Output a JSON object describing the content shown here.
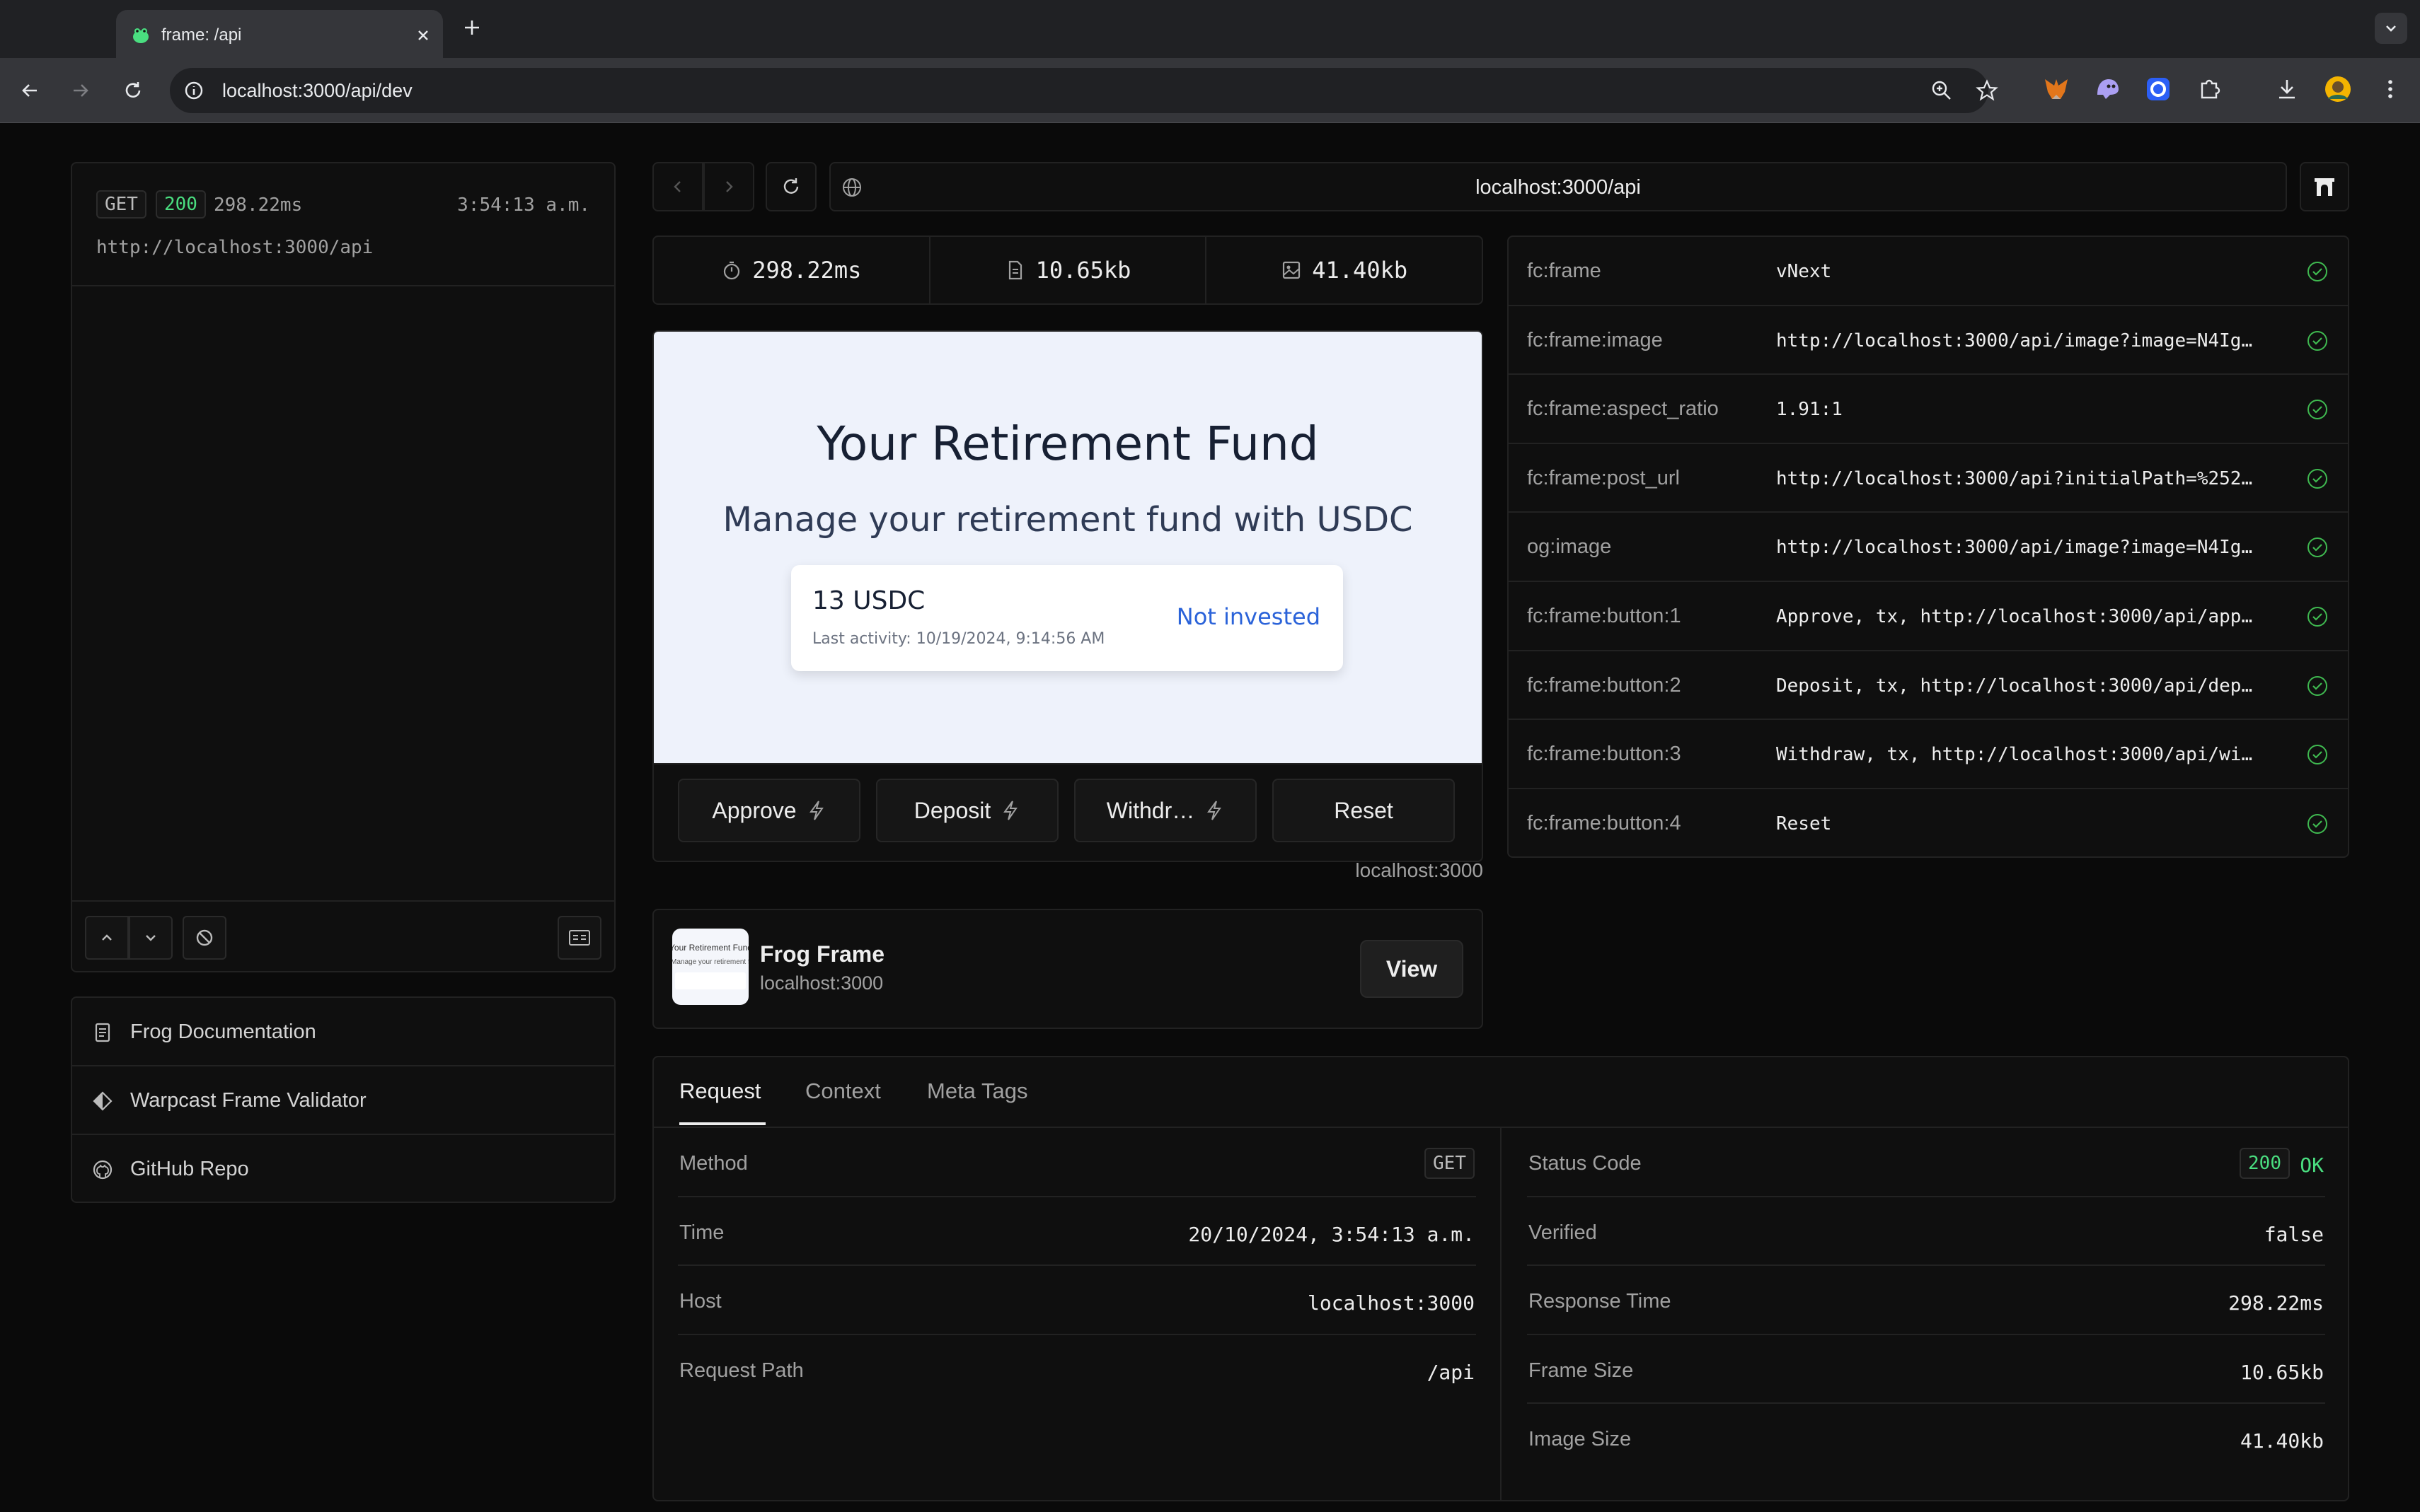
{
  "browser": {
    "tab_title": "frame: /api",
    "url": "localhost:3000/api/dev"
  },
  "log": {
    "method": "GET",
    "status": "200",
    "duration": "298.22ms",
    "time": "3:54:13 a.m.",
    "url": "http://localhost:3000/api"
  },
  "links": [
    {
      "label": "Frog Documentation",
      "icon": "document-icon"
    },
    {
      "label": "Warpcast Frame Validator",
      "icon": "warpcast-icon"
    },
    {
      "label": "GitHub Repo",
      "icon": "github-icon"
    }
  ],
  "navbar": {
    "url": "localhost:3000/api"
  },
  "metrics": {
    "time": "298.22ms",
    "frame_size": "10.65kb",
    "image_size": "41.40kb"
  },
  "frame": {
    "title": "Your Retirement Fund",
    "subtitle": "Manage your retirement fund with USDC",
    "amount": "13 USDC",
    "last_activity": "Last activity: 10/19/2024, 9:14:56 AM",
    "status": "Not invested",
    "buttons": [
      {
        "label": "Approve",
        "icon": "bolt-icon"
      },
      {
        "label": "Deposit",
        "icon": "bolt-icon"
      },
      {
        "label": "Withdr…",
        "icon": "bolt-icon"
      },
      {
        "label": "Reset"
      }
    ],
    "host": "localhost:3000",
    "thumb_title": "Your Retirement Fund",
    "thumb_sub": "Manage your retirement fund with USDC"
  },
  "cast": {
    "title": "Frog Frame",
    "host": "localhost:3000",
    "view_label": "View"
  },
  "meta_tags": [
    {
      "key": "fc:frame",
      "value": "vNext"
    },
    {
      "key": "fc:frame:image",
      "value": "http://localhost:3000/api/image?image=N4Ig…"
    },
    {
      "key": "fc:frame:aspect_ratio",
      "value": "1.91:1"
    },
    {
      "key": "fc:frame:post_url",
      "value": "http://localhost:3000/api?initialPath=%252…"
    },
    {
      "key": "og:image",
      "value": "http://localhost:3000/api/image?image=N4Ig…"
    },
    {
      "key": "fc:frame:button:1",
      "value": "Approve, tx, http://localhost:3000/api/app…"
    },
    {
      "key": "fc:frame:button:2",
      "value": "Deposit, tx, http://localhost:3000/api/dep…"
    },
    {
      "key": "fc:frame:button:3",
      "value": "Withdraw, tx, http://localhost:3000/api/wi…"
    },
    {
      "key": "fc:frame:button:4",
      "value": "Reset"
    }
  ],
  "request": {
    "tabs": [
      "Request",
      "Context",
      "Meta Tags"
    ],
    "method_label": "Method",
    "method": "GET",
    "time_label": "Time",
    "time": "20/10/2024, 3:54:13 a.m.",
    "host_label": "Host",
    "host": "localhost:3000",
    "path_label": "Request Path",
    "path": "/api",
    "status_label": "Status Code",
    "status_code": "200",
    "status_text": "OK",
    "verified_label": "Verified",
    "verified": "false",
    "response_time_label": "Response Time",
    "response_time": "298.22ms",
    "frame_size_label": "Frame Size",
    "frame_size": "10.65kb",
    "image_size_label": "Image Size",
    "image_size": "41.40kb"
  }
}
